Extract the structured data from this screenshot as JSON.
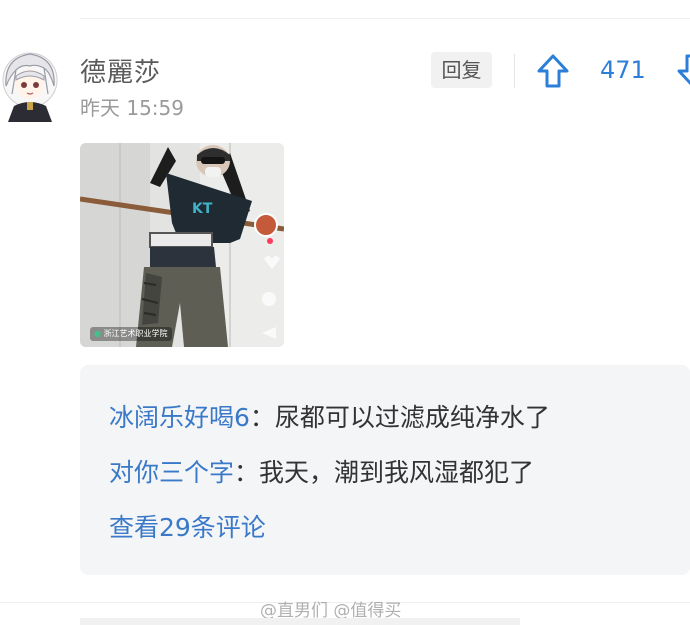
{
  "comment": {
    "username": "德麗莎",
    "timestamp": "昨天 15:59",
    "reply_label": "回复",
    "upvote_count": "471",
    "icons": {
      "avatar": "anime-avatar",
      "upvote": "up-arrow-icon",
      "downvote": "down-arrow-icon"
    },
    "media": {
      "type": "video-thumbnail",
      "location_tag": "浙江艺术职业学院"
    }
  },
  "replies": [
    {
      "author": "冰阔乐好喝6",
      "separator": "：",
      "text": "尿都可以过滤成纯净水了"
    },
    {
      "author": "对你三个字",
      "separator": "：",
      "text": "我天，潮到我风湿都犯了"
    }
  ],
  "view_more_label": "查看29条评论",
  "watermark": "@直男们 @值得买",
  "colors": {
    "link_blue": "#3a79c8",
    "count_blue": "#2b7fd8",
    "box_bg": "#f4f5f7"
  }
}
